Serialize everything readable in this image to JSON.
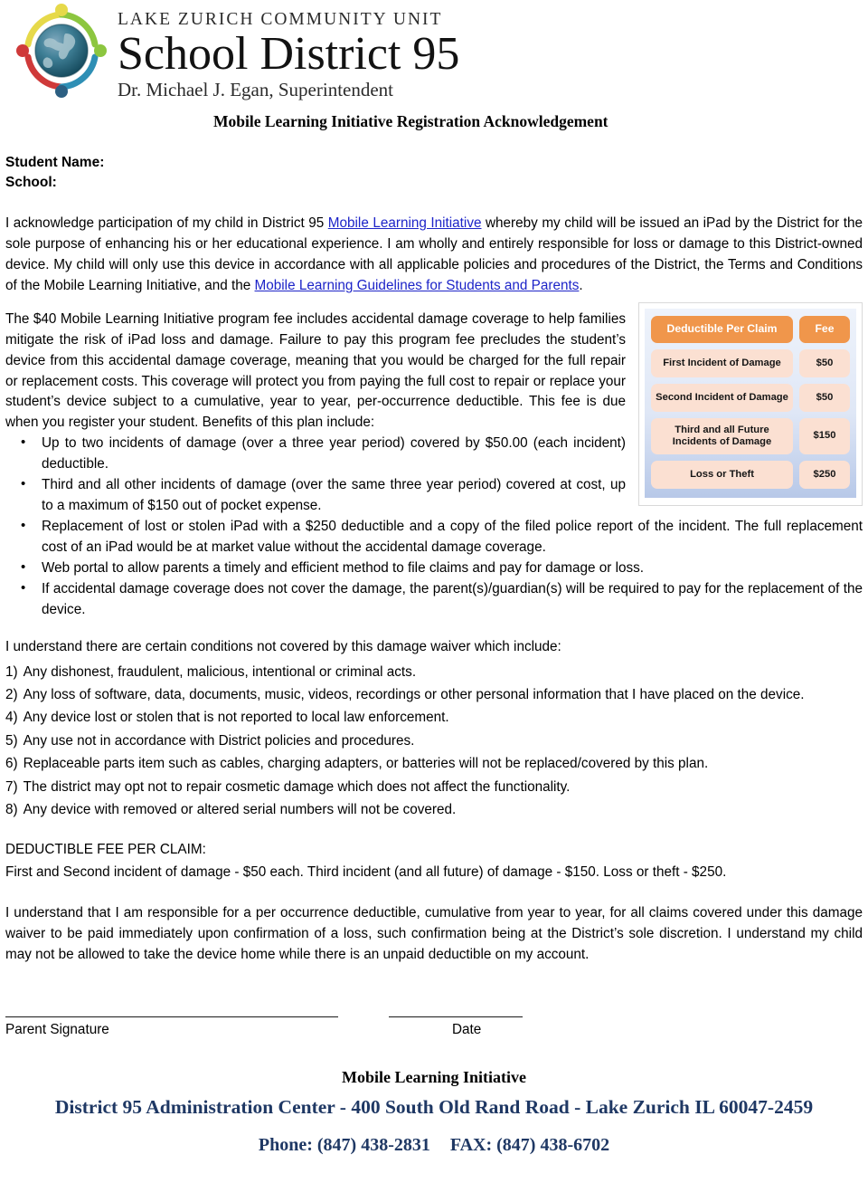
{
  "logo": {
    "line1": "LAKE ZURICH COMMUNITY UNIT",
    "line2": "School District 95",
    "line3": "Dr. Michael J. Egan, Superintendent",
    "icon": "globe-people-logo"
  },
  "document": {
    "title": "Mobile Learning Initiative Registration Acknowledgement"
  },
  "fields": {
    "student_name_label": "Student Name:",
    "school_label": "School:"
  },
  "paragraph1": {
    "part1": "I acknowledge participation of my child in District 95 ",
    "link1": "Mobile Learning Initiative",
    "part2": " whereby my child will be issued an iPad by the District for the sole purpose of enhancing his or her educational experience. I am wholly and entirely responsible for loss or damage to this District-owned device.  My child will only use this device in accordance with all applicable policies and procedures of the District, the Terms and Conditions of the Mobile Learning Initiative, and the ",
    "link2": "Mobile Learning Guidelines for Students and Parents",
    "part3": "."
  },
  "paragraph2": {
    "text": "The $40 Mobile Learning Initiative program fee includes accidental damage coverage to help families mitigate the risk of iPad loss and damage.  Failure to pay this program fee precludes the student’s device from this accidental damage coverage, meaning that you would be charged for the full repair or replacement costs.  This coverage will protect you from paying the full cost to repair or replace your student’s device subject to a cumulative, year to year, per-occurrence deductible. This fee is due when you register your student.   Benefits of this plan include:"
  },
  "fee_table": {
    "columns": [
      "Deductible Per Claim",
      "Fee"
    ],
    "rows": [
      {
        "label": "First Incident of Damage",
        "fee": "$50"
      },
      {
        "label": "Second Incident of Damage",
        "fee": "$50"
      },
      {
        "label": "Third and all Future Incidents of Damage",
        "fee": "$150"
      },
      {
        "label": "Loss or Theft",
        "fee": "$250"
      }
    ],
    "header_color": "#f0964b",
    "cell_color": "#fbe0d2",
    "panel_color": "#dfe7f6"
  },
  "benefits": [
    "Up to two incidents of damage (over a three year period) covered by $50.00 (each incident) deductible.",
    "Third and all other incidents of damage (over the same three year period) covered at cost, up to a maximum of $150 out of pocket expense.",
    "Replacement of lost or stolen iPad with a $250 deductible and a copy of the filed police report of the incident.  The full replacement cost of an iPad would be at market value without the accidental damage coverage.",
    "Web portal to allow parents a timely and efficient method to file claims and pay for damage or loss.",
    "If accidental damage coverage does not cover the damage, the parent(s)/guardian(s) will be required to pay for the replacement of the device."
  ],
  "conditions": {
    "lead": "I understand there are certain conditions not covered by this damage waiver which include:",
    "items": [
      {
        "num": "1)",
        "text": "Any dishonest, fraudulent, malicious, intentional or criminal acts."
      },
      {
        "num": "2)",
        "text": "Any loss of software, data, documents, music, videos, recordings or other personal information that I have placed on the device."
      },
      {
        "num": "4)",
        "text": "Any device lost or stolen that is not reported to local law enforcement."
      },
      {
        "num": "5)",
        "text": "Any use not in accordance with District policies and procedures."
      },
      {
        "num": "6)",
        "text": "Replaceable parts item such as cables, charging adapters, or batteries will not be replaced/covered by this plan."
      },
      {
        "num": "7)",
        "text": "The district may opt not to repair cosmetic damage which does not affect the functionality."
      },
      {
        "num": "8)",
        "text": "Any device with removed or altered serial numbers will not be covered."
      }
    ]
  },
  "deductible": {
    "heading": "DEDUCTIBLE FEE PER CLAIM:",
    "line": "First and Second incident of damage - $50 each.  Third incident (and all future) of damage - $150.  Loss or theft - $250."
  },
  "final_paragraph": {
    "text": "I understand that I am responsible for a per occurrence deductible, cumulative from year to year, for all claims covered under this damage waiver to be paid immediately upon confirmation of a loss, such confirmation being at the District’s sole discretion. I understand my child may not be allowed to take the device home while there is an unpaid deductible on my account."
  },
  "signature": {
    "parent_label": "Parent Signature",
    "date_label": "Date"
  },
  "footer": {
    "line1": "Mobile Learning Initiative",
    "line2": "District 95 Administration Center - 400 South Old Rand Road - Lake Zurich IL 60047-2459",
    "phone": "Phone: (847) 438-2831",
    "fax": "FAX: (847) 438-6702",
    "accent_color": "#1f3864"
  }
}
